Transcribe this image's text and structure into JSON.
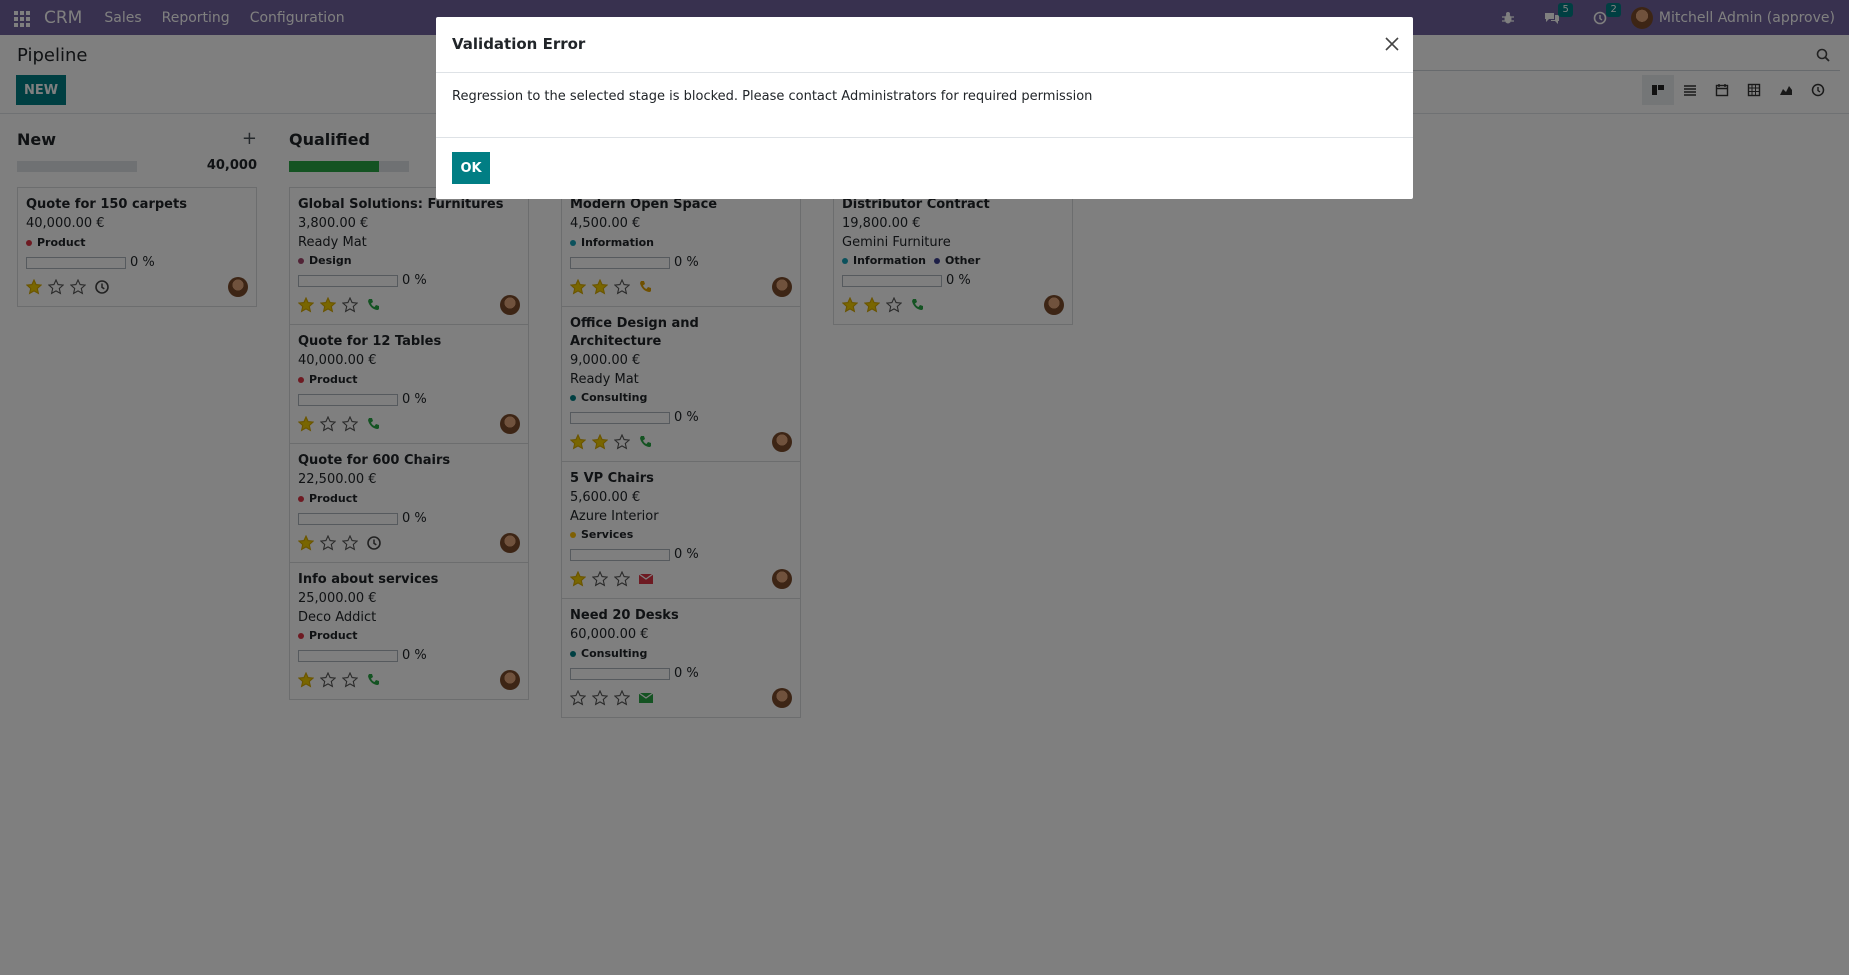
{
  "navbar": {
    "brand": "CRM",
    "menu": [
      "Sales",
      "Reporting",
      "Configuration"
    ],
    "messages_count": "5",
    "activities_count": "2",
    "user_name": "Mitchell Admin (approve)"
  },
  "control": {
    "breadcrumb": "Pipeline",
    "new_label": "NEW"
  },
  "columns": [
    {
      "title": "New",
      "total": "40,000",
      "progress": 0,
      "cards": [
        {
          "title": "Quote for 150 carpets",
          "amount": "40,000.00 €",
          "partner": "",
          "tags": [
            {
              "label": "Product",
              "color": "#dc3545"
            }
          ],
          "progress": "0 %",
          "stars": 1,
          "activity": "clock"
        }
      ]
    },
    {
      "title": "Qualified",
      "total": "",
      "progress": 0.75,
      "cards": [
        {
          "title": "Global Solutions: Furnitures",
          "amount": "3,800.00 €",
          "partner": "Ready Mat",
          "tags": [
            {
              "label": "Design",
              "color": "#a2466d"
            }
          ],
          "progress": "0 %",
          "stars": 2,
          "activity": "phone"
        },
        {
          "title": "Quote for 12 Tables",
          "amount": "40,000.00 €",
          "partner": "",
          "tags": [
            {
              "label": "Product",
              "color": "#dc3545"
            }
          ],
          "progress": "0 %",
          "stars": 1,
          "activity": "phone"
        },
        {
          "title": "Quote for 600 Chairs",
          "amount": "22,500.00 €",
          "partner": "",
          "tags": [
            {
              "label": "Product",
              "color": "#dc3545"
            }
          ],
          "progress": "0 %",
          "stars": 1,
          "activity": "clock"
        },
        {
          "title": "Info about services",
          "amount": "25,000.00 €",
          "partner": "Deco Addict",
          "tags": [
            {
              "label": "Product",
              "color": "#dc3545"
            }
          ],
          "progress": "0 %",
          "stars": 1,
          "activity": "phone"
        }
      ]
    },
    {
      "title": "",
      "total": "",
      "progress": 0,
      "cards": [
        {
          "title": "Modern Open Space",
          "amount": "4,500.00 €",
          "partner": "",
          "tags": [
            {
              "label": "Information",
              "color": "#17a2b8"
            }
          ],
          "progress": "0 %",
          "stars": 2,
          "activity": "phone-orange"
        },
        {
          "title": "Office Design and Architecture",
          "amount": "9,000.00 €",
          "partner": "Ready Mat",
          "tags": [
            {
              "label": "Consulting",
              "color": "#017e84"
            }
          ],
          "progress": "0 %",
          "stars": 2,
          "activity": "phone"
        },
        {
          "title": "5 VP Chairs",
          "amount": "5,600.00 €",
          "partner": "Azure Interior",
          "tags": [
            {
              "label": "Services",
              "color": "#ffc107"
            }
          ],
          "progress": "0 %",
          "stars": 1,
          "activity": "mail-red"
        },
        {
          "title": "Need 20 Desks",
          "amount": "60,000.00 €",
          "partner": "",
          "tags": [
            {
              "label": "Consulting",
              "color": "#017e84"
            }
          ],
          "progress": "0 %",
          "stars": 0,
          "activity": "mail-green"
        }
      ]
    },
    {
      "title": "",
      "total": "",
      "progress": 0,
      "cards": [
        {
          "title": "Distributor Contract",
          "amount": "19,800.00 €",
          "partner": "Gemini Furniture",
          "tags": [
            {
              "label": "Information",
              "color": "#17a2b8"
            },
            {
              "label": "Other",
              "color": "#3a3f8f"
            }
          ],
          "progress": "0 %",
          "stars": 2,
          "activity": "phone"
        }
      ]
    }
  ],
  "modal": {
    "title": "Validation Error",
    "message": "Regression to the selected stage is blocked. Please contact Administrators for required permission",
    "ok_label": "OK"
  }
}
